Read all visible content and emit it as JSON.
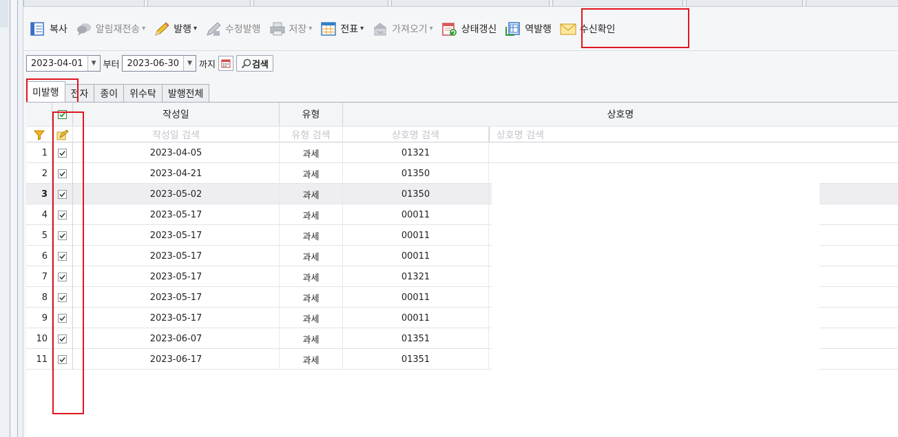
{
  "toolbar": {
    "items": [
      {
        "label": "복사",
        "icon": "copy-icon",
        "enabled": true,
        "dropdown": false
      },
      {
        "label": "알림재전송",
        "icon": "speech-bubble-icon",
        "enabled": false,
        "dropdown": true
      },
      {
        "label": "발행",
        "icon": "pencil-icon",
        "enabled": true,
        "dropdown": true
      },
      {
        "label": "수정발행",
        "icon": "edit-pencil-icon",
        "enabled": false,
        "dropdown": false
      },
      {
        "label": "저장",
        "icon": "printer-icon",
        "enabled": false,
        "dropdown": true
      },
      {
        "label": "전표",
        "icon": "table-icon",
        "enabled": true,
        "dropdown": true
      },
      {
        "label": "가져오기",
        "icon": "hometax-icon",
        "enabled": false,
        "dropdown": true
      },
      {
        "label": "상태갱신",
        "icon": "refresh-document-icon",
        "enabled": true,
        "dropdown": false
      },
      {
        "label": "역발행",
        "icon": "reverse-document-icon",
        "enabled": true,
        "dropdown": false
      },
      {
        "label": "수신확인",
        "icon": "envelope-icon",
        "enabled": true,
        "dropdown": false
      }
    ]
  },
  "filter": {
    "from_date": "2023-04-01",
    "from_label": "부터",
    "to_date": "2023-06-30",
    "to_label": "까지",
    "search_label": "검색"
  },
  "tabs": [
    {
      "label": "미발행",
      "active": true
    },
    {
      "label": "전자",
      "active": false
    },
    {
      "label": "종이",
      "active": false
    },
    {
      "label": "위수탁",
      "active": false
    },
    {
      "label": "발행전체",
      "active": false
    }
  ],
  "grid": {
    "headers": {
      "date": "작성일",
      "type": "유형",
      "name": "상호명"
    },
    "filters": {
      "date": "작성일 검색",
      "type": "유형 검색",
      "code": "상호명 검색",
      "name": "상호명 검색"
    },
    "selected_row": 3,
    "rows": [
      {
        "num": "1",
        "date": "2023-04-05",
        "type": "과세",
        "code": "01321",
        "checked": true
      },
      {
        "num": "2",
        "date": "2023-04-21",
        "type": "과세",
        "code": "01350",
        "checked": true
      },
      {
        "num": "3",
        "date": "2023-05-02",
        "type": "과세",
        "code": "01350",
        "checked": true
      },
      {
        "num": "4",
        "date": "2023-05-17",
        "type": "과세",
        "code": "00011",
        "checked": true
      },
      {
        "num": "5",
        "date": "2023-05-17",
        "type": "과세",
        "code": "00011",
        "checked": true
      },
      {
        "num": "6",
        "date": "2023-05-17",
        "type": "과세",
        "code": "00011",
        "checked": true
      },
      {
        "num": "7",
        "date": "2023-05-17",
        "type": "과세",
        "code": "01321",
        "checked": true
      },
      {
        "num": "8",
        "date": "2023-05-17",
        "type": "과세",
        "code": "00011",
        "checked": true
      },
      {
        "num": "9",
        "date": "2023-05-17",
        "type": "과세",
        "code": "00011",
        "checked": true
      },
      {
        "num": "10",
        "date": "2023-06-07",
        "type": "과세",
        "code": "01351",
        "checked": true
      },
      {
        "num": "11",
        "date": "2023-06-17",
        "type": "과세",
        "code": "01351",
        "checked": true
      }
    ]
  },
  "colors": {
    "highlight": "#e0141c",
    "accent_green": "#2e9c3a"
  }
}
